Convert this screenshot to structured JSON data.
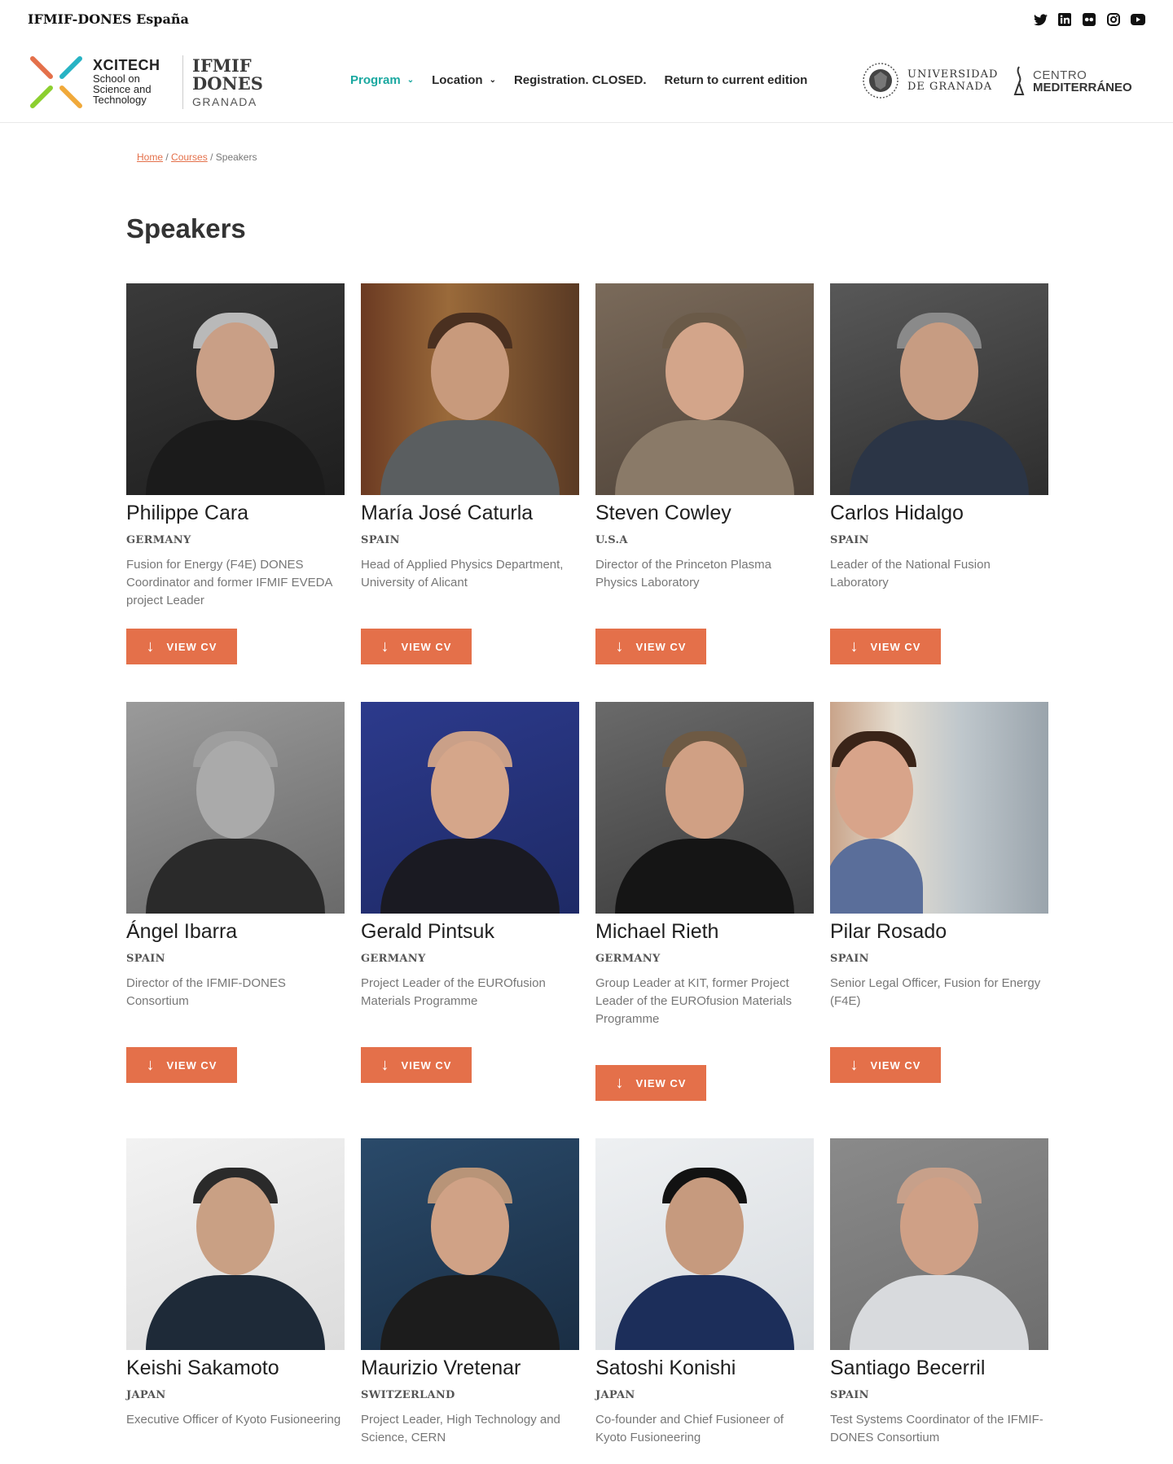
{
  "topbar": {
    "org": "IFMIF-DONES España",
    "social": [
      "twitter-icon",
      "linkedin-icon",
      "flickr-icon",
      "instagram-icon",
      "youtube-icon"
    ]
  },
  "logo": {
    "xcitech": "XCITECH",
    "xcitech_sub": [
      "School on",
      "Science and",
      "Technology"
    ],
    "ifmif": "IFMIF",
    "dones": "DONES",
    "granada": "GRANADA"
  },
  "nav": [
    {
      "label": "Program",
      "dropdown": true,
      "active": true
    },
    {
      "label": "Location",
      "dropdown": true,
      "active": false
    },
    {
      "label": "Registration. CLOSED.",
      "dropdown": false,
      "active": false
    },
    {
      "label": "Return to current edition",
      "dropdown": false,
      "active": false
    }
  ],
  "partners": {
    "ugr_line1": "UNIVERSIDAD",
    "ugr_line2": "DE GRANADA",
    "cm_line1": "CENTRO",
    "cm_line2": "MEDITERRÁNEO"
  },
  "breadcrumb": {
    "home": "Home",
    "courses": "Courses",
    "current": "Speakers",
    "sep": "/"
  },
  "page_title": "Speakers",
  "button_label": "VIEW CV",
  "colors": {
    "accent": "#e4704a",
    "nav_active": "#1aa8a0"
  },
  "speakers": [
    {
      "name": "Philippe Cara",
      "country": "GERMANY",
      "role": "Fusion for Energy (F4E) DONES Coordinator and former IFMIF EVEDA project Leader"
    },
    {
      "name": "María José Caturla",
      "country": "SPAIN",
      "role": "Head of Applied Physics Department, University of Alicant"
    },
    {
      "name": "Steven Cowley",
      "country": "U.S.A",
      "role": "Director of the Princeton Plasma Physics Laboratory"
    },
    {
      "name": "Carlos Hidalgo",
      "country": "SPAIN",
      "role": "Leader of the National Fusion Laboratory"
    },
    {
      "name": "Ángel Ibarra",
      "country": "SPAIN",
      "role": "Director of the IFMIF-DONES Consortium"
    },
    {
      "name": "Gerald Pintsuk",
      "country": "GERMANY",
      "role": "Project Leader of the EUROfusion Materials Programme"
    },
    {
      "name": "Michael Rieth",
      "country": "GERMANY",
      "role": "Group Leader at KIT, former Project Leader of the EUROfusion Materials Programme"
    },
    {
      "name": "Pilar Rosado",
      "country": "SPAIN",
      "role": "Senior Legal Officer, Fusion for Energy (F4E)"
    },
    {
      "name": "Keishi Sakamoto",
      "country": "JAPAN",
      "role": "Executive Officer of Kyoto Fusioneering"
    },
    {
      "name": "Maurizio Vretenar",
      "country": "SWITZERLAND",
      "role": "Project Leader, High Technology and Science, CERN"
    },
    {
      "name": "Satoshi Konishi",
      "country": "JAPAN",
      "role": "Co-founder and Chief Fusioneer of Kyoto Fusioneering"
    },
    {
      "name": "Santiago Becerril",
      "country": "SPAIN",
      "role": "Test Systems Coordinator of the IFMIF-DONES Consortium"
    }
  ]
}
